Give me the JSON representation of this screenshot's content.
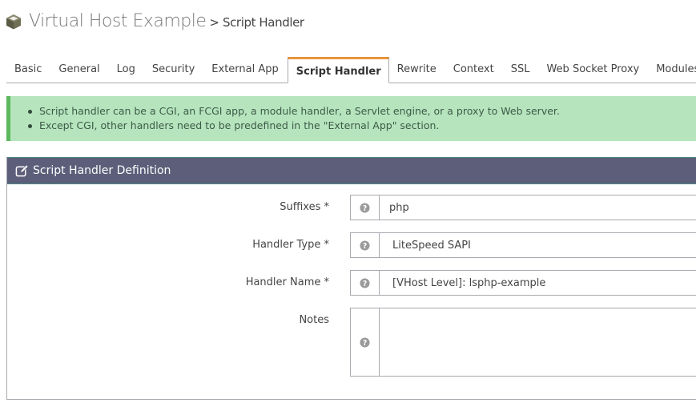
{
  "header": {
    "title": "Virtual Host Example",
    "breadcrumb": "> Script Handler",
    "icon": "cube-icon"
  },
  "tabs": [
    {
      "label": "Basic",
      "active": false
    },
    {
      "label": "General",
      "active": false
    },
    {
      "label": "Log",
      "active": false
    },
    {
      "label": "Security",
      "active": false
    },
    {
      "label": "External App",
      "active": false
    },
    {
      "label": "Script Handler",
      "active": true
    },
    {
      "label": "Rewrite",
      "active": false
    },
    {
      "label": "Context",
      "active": false
    },
    {
      "label": "SSL",
      "active": false
    },
    {
      "label": "Web Socket Proxy",
      "active": false
    },
    {
      "label": "Modules",
      "active": false
    }
  ],
  "alert": {
    "items": [
      "Script handler can be a CGI, an FCGI app, a module handler, a Servlet engine, or a proxy to Web server.",
      "Except CGI, other handlers need to be predefined in the \"External App\" section."
    ]
  },
  "panel": {
    "title": "Script Handler Definition",
    "icon": "edit-icon",
    "fields": [
      {
        "label": "Suffixes *",
        "value": "php",
        "help_icon": "question-circle-icon"
      },
      {
        "label": "Handler Type *",
        "value": "LiteSpeed SAPI",
        "help_icon": "question-circle-icon"
      },
      {
        "label": "Handler Name *",
        "value": "[VHost Level]: lsphp-example",
        "help_icon": "question-circle-icon"
      },
      {
        "label": "Notes",
        "value": "",
        "help_icon": "question-circle-icon"
      }
    ]
  },
  "colors": {
    "active_tab_accent": "#e8943a",
    "alert_bg": "#b6e5bd",
    "alert_border": "#5cb85c",
    "panel_header_bg": "#5c5e7a"
  }
}
